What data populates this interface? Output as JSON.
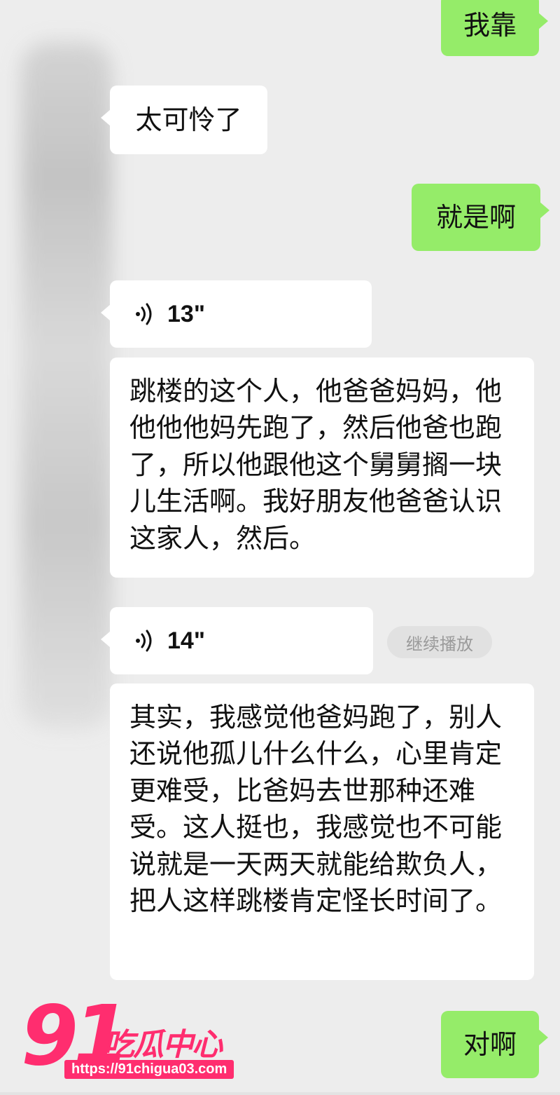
{
  "colors": {
    "background": "#ededed",
    "incoming": "#ffffff",
    "outgoing": "#95ec69",
    "watermark": "#ff2d6f"
  },
  "messages": {
    "m1": "我靠",
    "m2": "太可怜了",
    "m3": "就是啊",
    "v1_duration": "13\"",
    "m4": "跳楼的这个人，他爸爸妈妈，他他他他妈先跑了，然后他爸也跑了，所以他跟他这个舅舅搁一块儿生活啊。我好朋友他爸爸认识这家人，然后。",
    "v2_duration": "14\"",
    "continue_label": "继续播放",
    "m5": "其实，我感觉他爸妈跑了，别人还说他孤儿什么什么，心里肯定更难受，比爸妈去世那种还难受。这人挺也，我感觉也不可能说就是一天两天就能给欺负人，把人这样跳楼肯定怪长时间了。",
    "m6": "对啊"
  },
  "watermark": {
    "number": "91",
    "name": "吃瓜中心",
    "url": "https://91chigua03.com"
  },
  "icons": [
    "voice-wave-icon"
  ]
}
